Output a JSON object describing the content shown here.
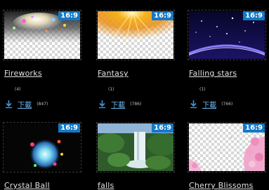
{
  "accent_color": "#1479c6",
  "link_color": "#6cb7f0",
  "download_icon": "download-arrow-icon",
  "items": [
    {
      "title": "Fireworks",
      "badge": "16:9",
      "count": "(4)",
      "download_label": "下載",
      "download_count": "(847)"
    },
    {
      "title": "Fantasy",
      "badge": "16:9",
      "count": "(1)",
      "download_label": "下載",
      "download_count": "(786)"
    },
    {
      "title": "Falling stars",
      "badge": "16:9",
      "count": "(1)",
      "download_label": "下載",
      "download_count": "(766)"
    },
    {
      "title": "Crystal Ball",
      "badge": "16:9"
    },
    {
      "title": "falls",
      "badge": "16:9"
    },
    {
      "title": "Cherry Blissoms",
      "badge": "16:9"
    }
  ]
}
